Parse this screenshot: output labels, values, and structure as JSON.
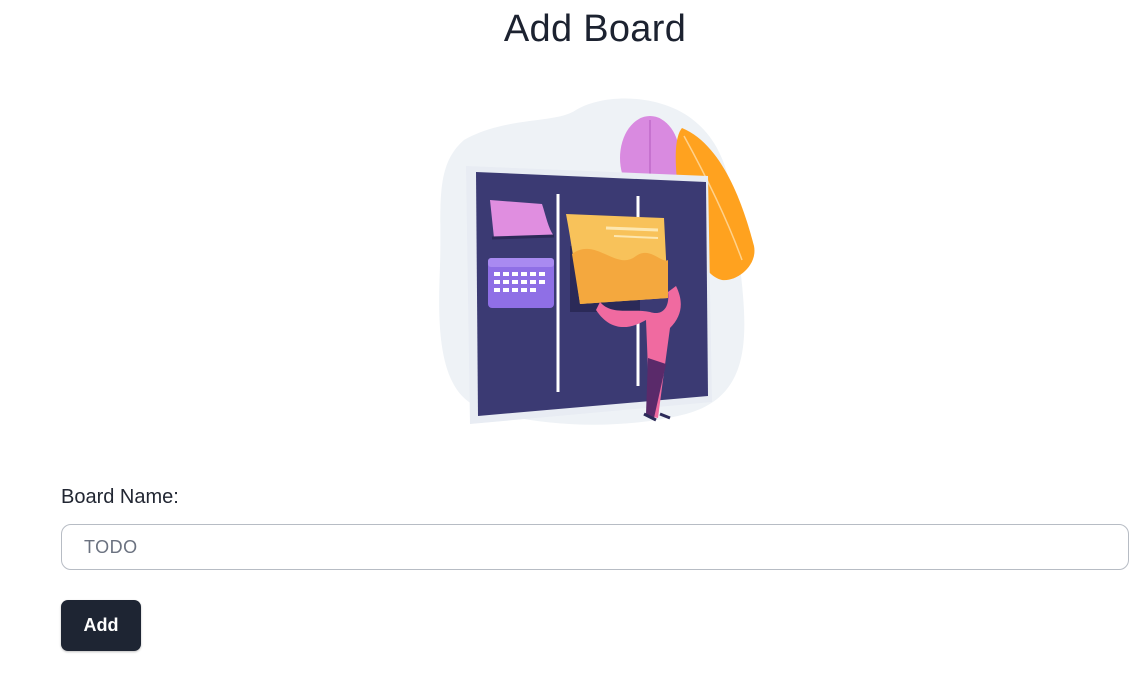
{
  "page": {
    "title": "Add Board"
  },
  "illustration": {
    "name": "kanban-board-illustration",
    "colors": {
      "board": "#3b3a73",
      "blob": "#eef1f5",
      "pink_note": "#e08ee0",
      "calendar": "#8f6fe6",
      "yellow_note": "#f8c25a",
      "orange_leaf": "#ffa21f",
      "purple_leaf": "#d98ae0",
      "person_shirt": "#f06aa0",
      "person_pants": "#5a2a6a"
    }
  },
  "form": {
    "label": "Board Name:",
    "input_value": "TODO",
    "input_placeholder": "",
    "submit_label": "Add"
  },
  "colors": {
    "button_bg": "#1e2533",
    "button_text": "#ffffff",
    "input_border": "#b7bcc4"
  }
}
